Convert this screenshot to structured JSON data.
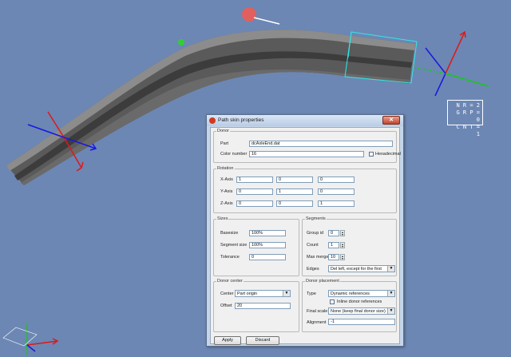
{
  "stats": {
    "nr": "N R = 2",
    "grp": "G R P = 0",
    "cnt": "C N T = 1"
  },
  "dialog": {
    "title": "Path skin properties",
    "donor": {
      "label": "Donor",
      "part_label": "Part",
      "part_value": "dcAxleEnd.dat",
      "color_label": "Color number",
      "color_value": "16",
      "hex_label": "Hexadecimal"
    },
    "rotation": {
      "label": "Rotation",
      "x_label": "X-Axis",
      "x": [
        "1",
        "0",
        "0"
      ],
      "y_label": "Y-Axis",
      "y": [
        "0",
        "1",
        "0"
      ],
      "z_label": "Z-Axis",
      "z": [
        "0",
        "0",
        "1"
      ]
    },
    "sizes": {
      "label": "Sizes",
      "basesize_label": "Basesize",
      "basesize": "100%",
      "segsize_label": "Segment size",
      "segsize": "100%",
      "tolerance_label": "Tolerance",
      "tolerance": "0"
    },
    "segments": {
      "label": "Segments",
      "group_label": "Group id",
      "group": "0",
      "count_label": "Count",
      "count": "1",
      "maxmerge_label": "Max merge",
      "maxmerge": "10",
      "edges_label": "Edges",
      "edges": "Del left, except for the first"
    },
    "center": {
      "label": "Donor center",
      "center_label": "Center",
      "center": "Part origin",
      "offset_label": "Offset",
      "offset": "20"
    },
    "placement": {
      "label": "Donor placement",
      "type_label": "Type",
      "type": "Dynamic references",
      "inline_label": "Inline donor references",
      "finalscale_label": "Final scale",
      "finalscale": "None (keep final donor size)",
      "alignment_label": "Alignment",
      "alignment": "-1"
    },
    "apply": "Apply",
    "discard": "Discard"
  },
  "colors": {
    "background": "#6c87b4",
    "axis_x": "#e01818",
    "axis_y": "#18c818",
    "axis_z": "#1818e0",
    "selection": "#33e6e6"
  }
}
